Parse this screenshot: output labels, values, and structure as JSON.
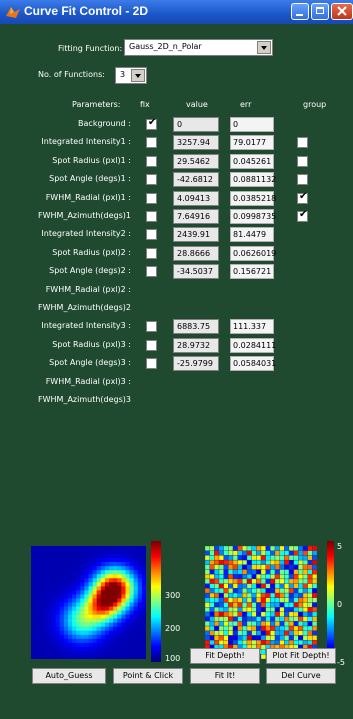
{
  "window": {
    "title": "Curve Fit Control - 2D"
  },
  "fitting_function": {
    "label": "Fitting Function:",
    "value": "Gauss_2D_n_Polar"
  },
  "num_functions": {
    "label": "No. of Functions:",
    "value": "3"
  },
  "table": {
    "headers": {
      "parameters": "Parameters:",
      "fix": "fix",
      "value": "value",
      "err": "err",
      "group": "group"
    },
    "rows": [
      {
        "label": "Background :",
        "fix": "true",
        "value": "0",
        "err": "0",
        "group": ""
      },
      {
        "label": "Integrated Intensity1 :",
        "fix": "false",
        "value": "3257.94",
        "err": "79.0177",
        "group": "false"
      },
      {
        "label": "Spot Radius (pxl)1 :",
        "fix": "false",
        "value": "29.5462",
        "err": "0.045261",
        "group": "false"
      },
      {
        "label": "Spot Angle (degs)1 :",
        "fix": "false",
        "value": "-42.6812",
        "err": "0.0881132",
        "group": "false"
      },
      {
        "label": "FWHM_Radial (pxl)1 :",
        "fix": "false",
        "value": "4.09413",
        "err": "0.0385218",
        "group": "true"
      },
      {
        "label": "FWHM_Azimuth(degs)1",
        "fix": "false",
        "value": "7.64916",
        "err": "0.0998735",
        "group": "true"
      },
      {
        "label": "Integrated Intensity2 :",
        "fix": "false",
        "value": "2439.91",
        "err": "81.4479",
        "group": ""
      },
      {
        "label": "Spot Radius (pxl)2 :",
        "fix": "false",
        "value": "28.8666",
        "err": "0.0626019",
        "group": ""
      },
      {
        "label": "Spot Angle (degs)2 :",
        "fix": "false",
        "value": "-34.5037",
        "err": "0.156721",
        "group": ""
      },
      {
        "label": "FWHM_Radial (pxl)2 :",
        "fix": "",
        "value": "",
        "err": "",
        "group": ""
      },
      {
        "label": "FWHM_Azimuth(degs)2",
        "fix": "",
        "value": "",
        "err": "",
        "group": ""
      },
      {
        "label": "Integrated Intensity3 :",
        "fix": "false",
        "value": "6883.75",
        "err": "111.337",
        "group": ""
      },
      {
        "label": "Spot Radius (pxl)3 :",
        "fix": "false",
        "value": "28.9732",
        "err": "0.0284111",
        "group": ""
      },
      {
        "label": "Spot Angle (degs)3 :",
        "fix": "false",
        "value": "-25.9799",
        "err": "0.0584031",
        "group": ""
      },
      {
        "label": "FWHM_Radial (pxl)3 :",
        "fix": "",
        "value": "",
        "err": "",
        "group": ""
      },
      {
        "label": "FWHM_Azimuth(degs)3",
        "fix": "",
        "value": "",
        "err": "",
        "group": ""
      }
    ]
  },
  "colorbar_left": {
    "ticks": [
      "300",
      "200",
      "100"
    ]
  },
  "colorbar_right": {
    "ticks": [
      "5",
      "0",
      "-5"
    ]
  },
  "buttons": {
    "fit_depth": "Fit Depth!",
    "plot_fit_depth": "Plot Fit Depth!",
    "auto_guess": "Auto_Guess",
    "point_click": "Point & Click",
    "fit_it": "Fit It!",
    "del_curve": "Del Curve"
  },
  "colors": {
    "background": "#1f4a2f",
    "titlebar": "#1a56c8"
  }
}
